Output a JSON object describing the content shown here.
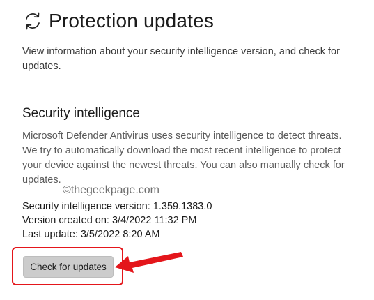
{
  "header": {
    "icon": "refresh-icon",
    "title": "Protection updates",
    "description": "View information about your security intelligence version, and check for updates."
  },
  "section": {
    "title": "Security intelligence",
    "description": "Microsoft Defender Antivirus uses security intelligence to detect threats. We try to automatically download the most recent intelligence to protect your device against the newest threats. You can also manually check for updates."
  },
  "watermark": "©thegeekpage.com",
  "info": {
    "version": "Security intelligence version: 1.359.1383.0",
    "created": "Version created on: 3/4/2022 11:32 PM",
    "last_update": "Last update: 3/5/2022 8:20 AM"
  },
  "button": {
    "label": "Check for updates"
  },
  "annotation": {
    "highlight_color": "#e4161b",
    "arrow_icon": "red-arrow-icon"
  }
}
